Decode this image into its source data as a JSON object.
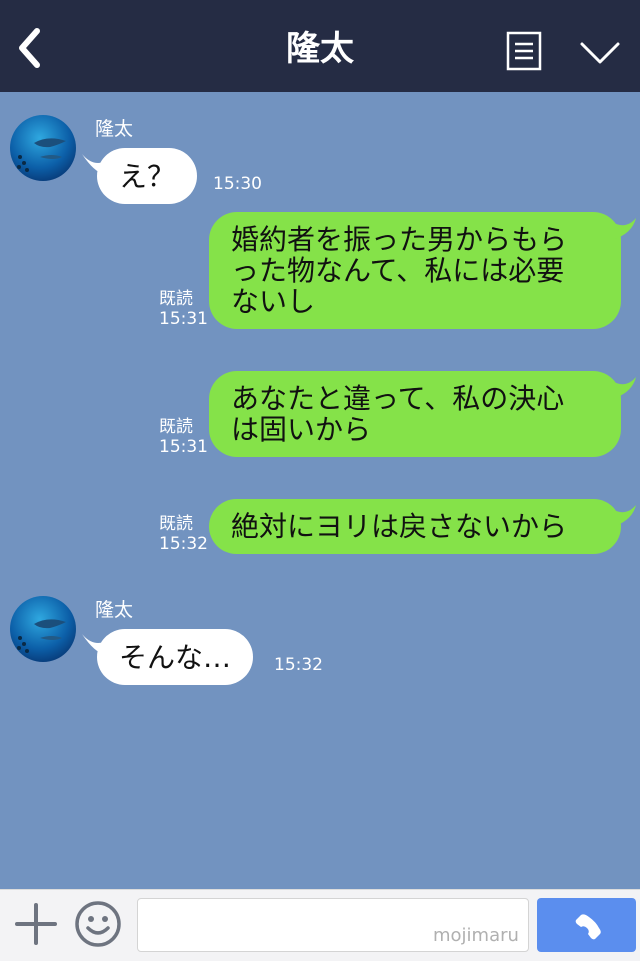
{
  "header": {
    "title": "隆太",
    "icons": {
      "back": "chevron-left-icon",
      "menu": "document-list-icon",
      "expand": "chevron-down-icon"
    }
  },
  "messages": [
    {
      "type": "in",
      "sender": "隆太",
      "text": "え？",
      "time": "15:30"
    },
    {
      "type": "out",
      "read": "既読",
      "time": "15:31",
      "lines": [
        "婚約者を振った男からもら",
        "った物なんて、私には必要",
        "ないし"
      ]
    },
    {
      "type": "out",
      "read": "既読",
      "time": "15:31",
      "lines": [
        "あなたと違って、私の決心",
        "は固いから"
      ]
    },
    {
      "type": "out",
      "read": "既読",
      "time": "15:32",
      "lines": [
        "絶対にヨリは戻さないから"
      ]
    },
    {
      "type": "in",
      "sender": "隆太",
      "text": "そんな…",
      "time": "15:32"
    }
  ],
  "footer": {
    "input_value": "",
    "watermark": "mojimaru",
    "icons": {
      "plus": "plus-icon",
      "emoji": "smiley-icon",
      "call": "phone-icon"
    }
  },
  "colors": {
    "header_bg": "#252c44",
    "chat_bg": "#7293c0",
    "incoming_bubble": "#ffffff",
    "outgoing_bubble": "#85e249",
    "call_button": "#5b8eee"
  }
}
